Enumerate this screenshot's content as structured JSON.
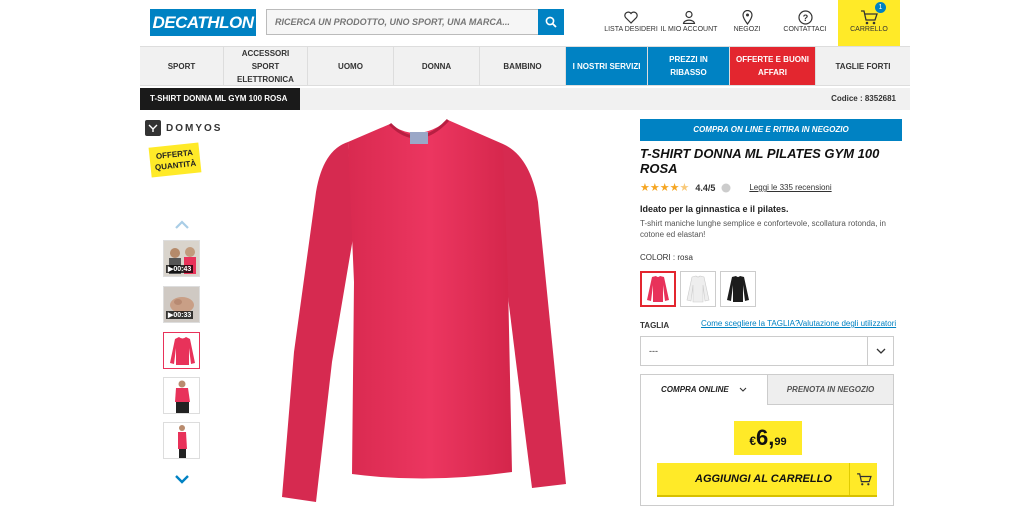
{
  "header": {
    "logo": "DECATHLON",
    "search_placeholder": "RICERCA UN PRODOTTO, UNO SPORT, UNA MARCA...",
    "icons": [
      {
        "icon": "heart-icon",
        "label": "LISTA DESIDERI"
      },
      {
        "icon": "user-icon",
        "label": "IL MIO ACCOUNT"
      },
      {
        "icon": "map-pin-icon",
        "label": "NEGOZI"
      },
      {
        "icon": "help-icon",
        "label": "CONTATTACI"
      }
    ],
    "cart": {
      "label": "CARRELLO",
      "count": "1",
      "bg": "#ffea28"
    }
  },
  "nav": [
    {
      "label": "SPORT",
      "style": "normal"
    },
    {
      "label": "ACCESSORI SPORT ELETTRONICA",
      "style": "normal"
    },
    {
      "label": "UOMO",
      "style": "normal"
    },
    {
      "label": "DONNA",
      "style": "normal"
    },
    {
      "label": "BAMBINO",
      "style": "normal"
    },
    {
      "label": "I NOSTRI SERVIZI",
      "style": "blue"
    },
    {
      "label": "PREZZI IN RIBASSO",
      "style": "blue"
    },
    {
      "label": "OFFERTE E BUONI AFFARI",
      "style": "red"
    },
    {
      "label": "TAGLIE FORTI",
      "style": "normal"
    }
  ],
  "breadcrumb": {
    "title": "T-SHIRT DONNA ML GYM 100 ROSA",
    "code": "Codice : 8352681"
  },
  "brand": {
    "name": "DOMYOS",
    "offer": "OFFERTA QUANTITÀ"
  },
  "thumbnails": [
    {
      "type": "video",
      "duration": "00:43"
    },
    {
      "type": "video",
      "duration": "00:33"
    },
    {
      "type": "image"
    },
    {
      "type": "image"
    },
    {
      "type": "image"
    }
  ],
  "product": {
    "pickup_banner": "COMPRA ON LINE E RITIRA IN NEGOZIO",
    "title": "T-SHIRT DONNA ML PILATES GYM 100 ROSA",
    "rating": "4.4/5",
    "stars": 4.4,
    "reviews_link": "Leggi le 335 recensioni",
    "tagline": "Ideato per la ginnastica e il pilates.",
    "description": "T-shirt maniche lunghe semplice e confortevole, scollatura rotonda, in cotone ed elastan!",
    "colors_label": "COLORI : rosa",
    "colors": [
      {
        "name": "rosa",
        "hex": "#e8325a",
        "selected": true
      },
      {
        "name": "bianco",
        "hex": "#f2f2f2",
        "selected": false
      },
      {
        "name": "nero",
        "hex": "#1c1c1c",
        "selected": false
      }
    ],
    "size_label": "TAGLIA",
    "size_guide_link": "Come scegliere la TAGLIA?",
    "size_reviews_link": "Valutazione degli utilizzatori",
    "size_value": "---",
    "tab_online": "COMPRA ONLINE",
    "tab_store": "PRENOTA IN NEGOZIO",
    "price_currency": "€",
    "price_int": "6,",
    "price_dec": "99",
    "add_to_cart": "AGGIUNGI AL CARRELLO"
  },
  "colors": {
    "brand_blue": "#0082c3",
    "accent_yellow": "#ffea28",
    "promo_red": "#e3262f",
    "shirt_pink": "#e8325a"
  }
}
